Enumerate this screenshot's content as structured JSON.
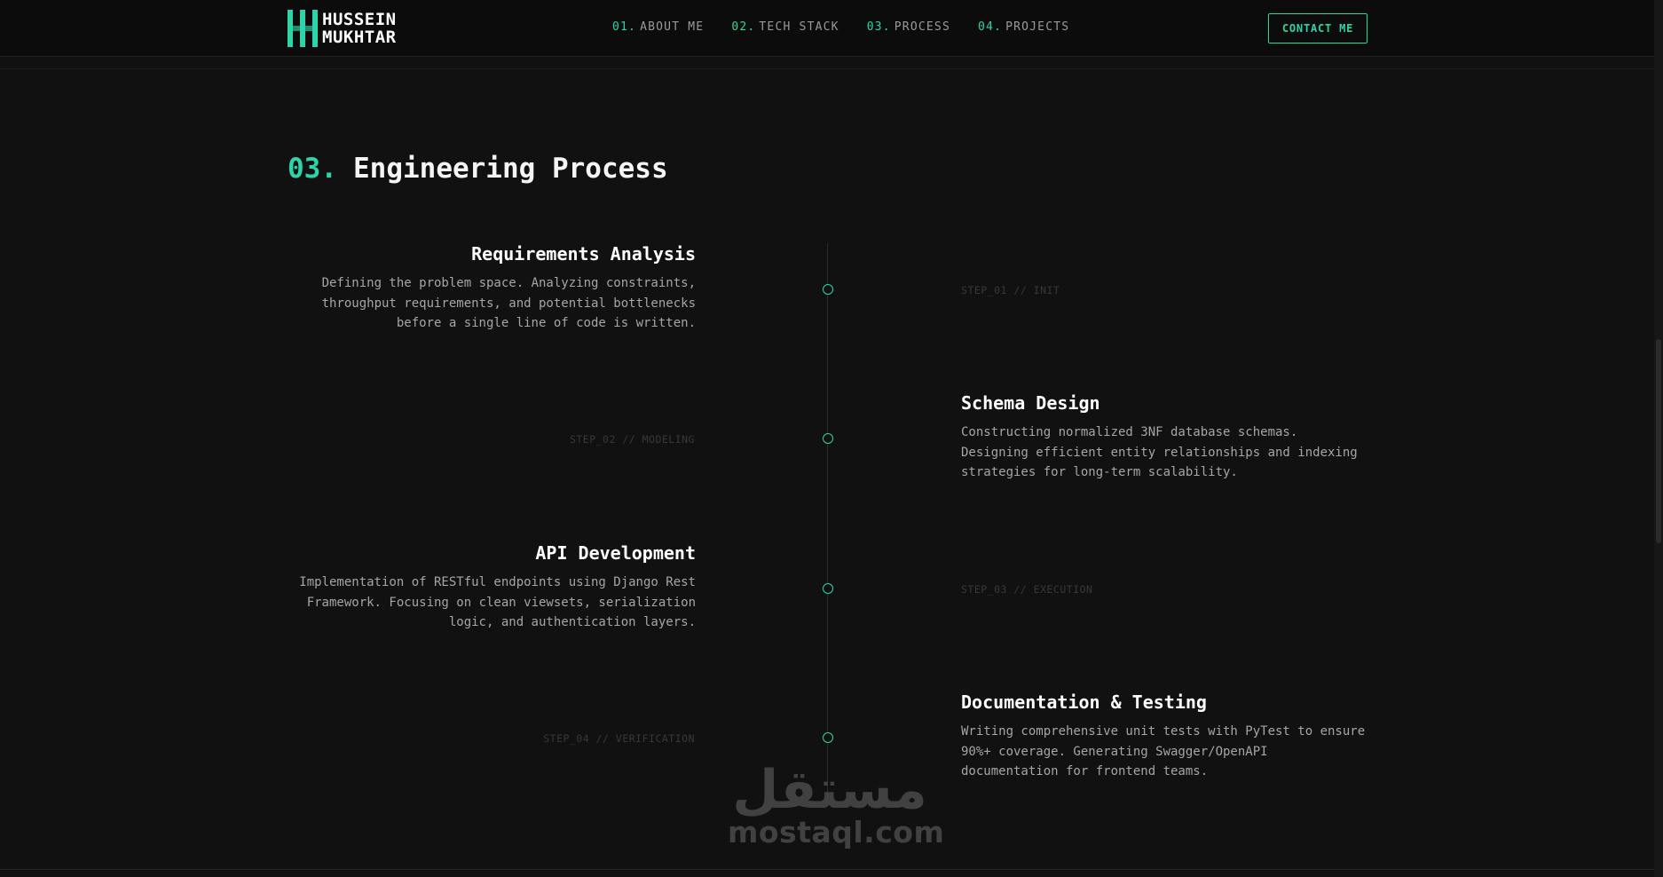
{
  "header": {
    "logo": {
      "line1": "HUSSEIN",
      "line2": "MUKHTAR"
    },
    "nav": [
      {
        "num": "01.",
        "label": "ABOUT ME"
      },
      {
        "num": "02.",
        "label": "TECH STACK"
      },
      {
        "num": "03.",
        "label": "PROCESS"
      },
      {
        "num": "04.",
        "label": "PROJECTS"
      }
    ],
    "contact_label": "CONTACT ME"
  },
  "section": {
    "num": "03.",
    "title": "Engineering Process"
  },
  "steps": [
    {
      "title": "Requirements Analysis",
      "description": "Defining the problem space. Analyzing constraints, throughput requirements, and potential bottlenecks before a single line of code is written.",
      "tag": "STEP_01 // INIT"
    },
    {
      "title": "Schema Design",
      "description": "Constructing normalized 3NF database schemas. Designing efficient entity relationships and indexing strategies for long-term scalability.",
      "tag": "STEP_02 // MODELING"
    },
    {
      "title": "API Development",
      "description": "Implementation of RESTful endpoints using Django Rest Framework. Focusing on clean viewsets, serialization logic, and authentication layers.",
      "tag": "STEP_03 // EXECUTION"
    },
    {
      "title": "Documentation & Testing",
      "description": "Writing comprehensive unit tests with PyTest to ensure 90%+ coverage. Generating Swagger/OpenAPI documentation for frontend teams.",
      "tag": "STEP_04 // VERIFICATION"
    }
  ],
  "watermark": {
    "arabic": "مستقل",
    "latin": "mostaql.com"
  },
  "colors": {
    "accent": "#2dd4a7",
    "background": "#111111",
    "header_background": "#0c0c0c",
    "text_primary": "#ffffff",
    "text_secondary": "#a6a6a6"
  }
}
